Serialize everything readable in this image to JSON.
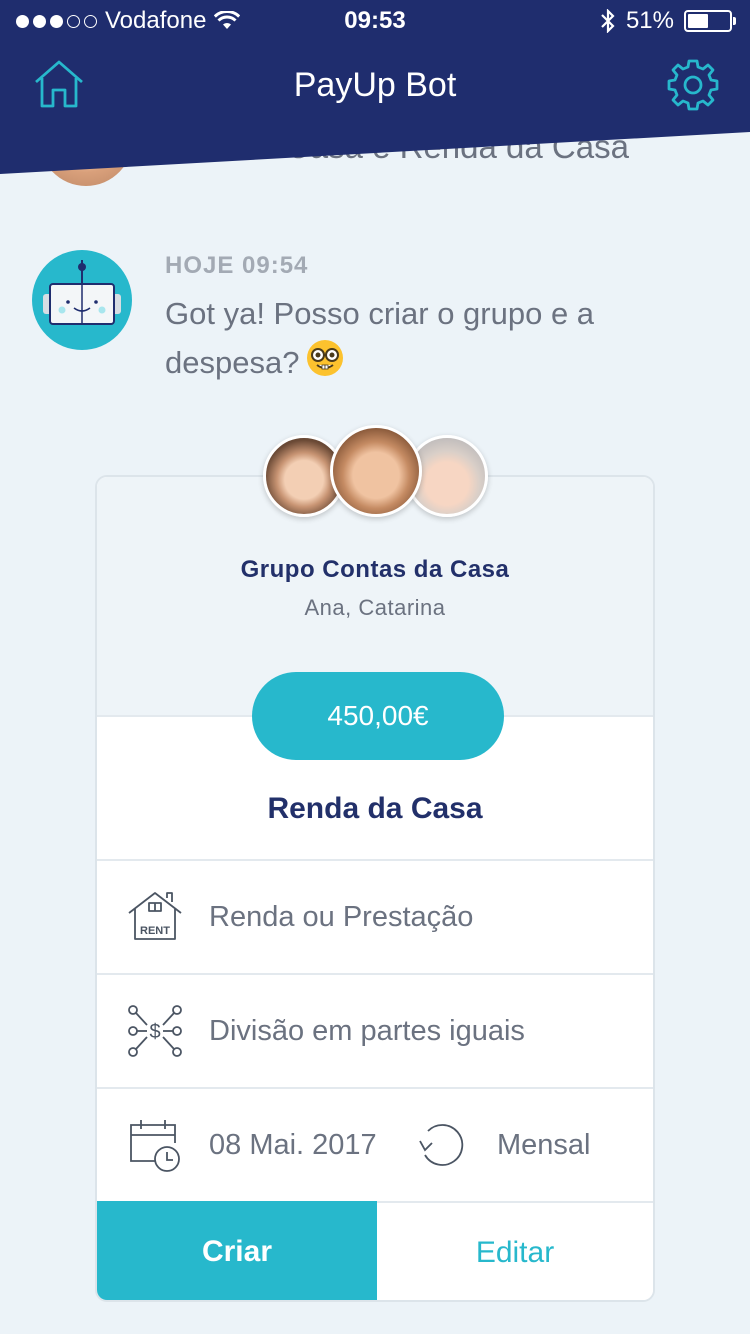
{
  "status_bar": {
    "carrier": "Vodafone",
    "time": "09:53",
    "battery": "51%",
    "battery_level": 0.51,
    "signal_bars": 3,
    "signal_total": 5
  },
  "nav": {
    "title": "PayUp Bot",
    "home_icon": "home-icon",
    "settings_icon": "gear-icon"
  },
  "previous_message": {
    "text": "da Casa e Renda da Casa"
  },
  "bot_message": {
    "time": "HOJE 09:54",
    "text": "Got ya! Posso criar o grupo e a despesa?",
    "emoji": "nerd-face-emoji"
  },
  "card": {
    "group_name": "Grupo Contas da Casa",
    "members": "Ana, Catarina",
    "amount": "450,00€",
    "expense_title": "Renda da Casa",
    "category": "Renda ou Prestação",
    "split": "Divisão em partes iguais",
    "date": "08 Mai. 2017",
    "recurrence": "Mensal",
    "create_label": "Criar",
    "edit_label": "Editar"
  },
  "colors": {
    "header": "#1f2d6e",
    "accent": "#27b8cc",
    "background": "#ecf3f8",
    "title_text": "#22306a"
  }
}
